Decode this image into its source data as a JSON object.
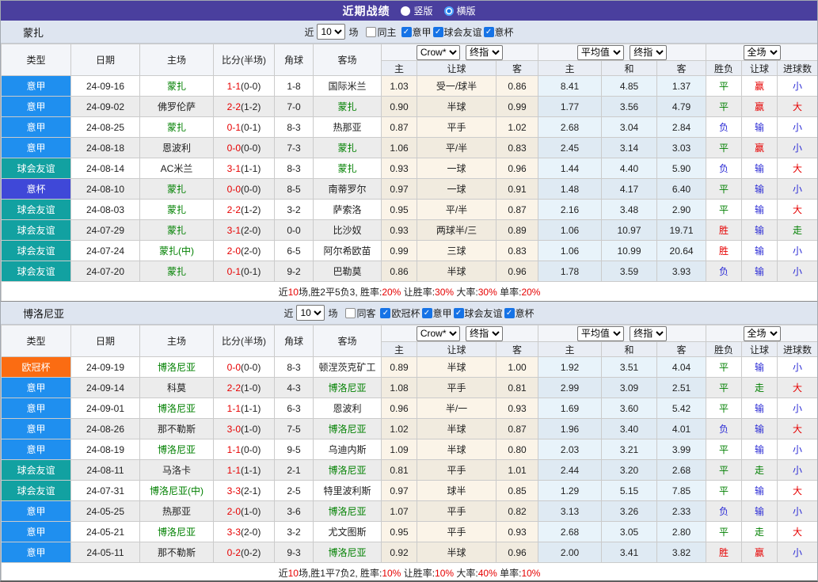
{
  "title_bar": {
    "title": "近期战绩",
    "vertical_label": "竖版",
    "horizontal_label": "横版",
    "selected": "横版"
  },
  "columns": {
    "type": "类型",
    "date": "日期",
    "home": "主场",
    "score": "比分(半场)",
    "corner": "角球",
    "away": "客场",
    "h_home": "主",
    "h_line": "让球",
    "h_away": "客",
    "avg_home": "主",
    "avg_draw": "和",
    "avg_away": "客",
    "result": "胜负",
    "h_result": "让球",
    "g_result": "进球数"
  },
  "type_colors": {
    "意甲": "#1f8fef",
    "球会友谊": "#12a1a1",
    "意杯": "#3f48d8",
    "欧冠杯": "#fb6c12"
  },
  "result_colors": {
    "胜": "#e60000",
    "平": "#008000",
    "负": "#2b2bd5",
    "赢": "#e60000",
    "走": "#008000",
    "输": "#2b2bd5",
    "大": "#e60000",
    "小": "#2b2bd5"
  },
  "sections": [
    {
      "team": "蒙扎",
      "filter": {
        "near_label": "近",
        "games_value": "10",
        "games_suffix": "场",
        "same_label": "同主",
        "same_checked": false,
        "leagues": [
          "意甲",
          "球会友谊",
          "意杯"
        ]
      },
      "dropdowns": {
        "company": "Crow*",
        "company_time": "终指",
        "average": "平均值",
        "average_time": "终指",
        "scope": "全场"
      },
      "rows": [
        {
          "type": "意甲",
          "date": "24-09-16",
          "home": "蒙扎",
          "home_hl": true,
          "score": "1-1",
          "half": "(0-0)",
          "corner": "1-8",
          "away": "国际米兰",
          "away_hl": false,
          "h_home": "1.03",
          "h_line": "受一/球半",
          "h_away": "0.86",
          "avg_home": "8.41",
          "avg_draw": "4.85",
          "avg_away": "1.37",
          "res": "平",
          "h_res": "赢",
          "g_res": "小"
        },
        {
          "type": "意甲",
          "date": "24-09-02",
          "home": "佛罗伦萨",
          "home_hl": false,
          "score": "2-2",
          "half": "(1-2)",
          "corner": "7-0",
          "away": "蒙扎",
          "away_hl": true,
          "h_home": "0.90",
          "h_line": "半球",
          "h_away": "0.99",
          "avg_home": "1.77",
          "avg_draw": "3.56",
          "avg_away": "4.79",
          "res": "平",
          "h_res": "赢",
          "g_res": "大"
        },
        {
          "type": "意甲",
          "date": "24-08-25",
          "home": "蒙扎",
          "home_hl": true,
          "score": "0-1",
          "half": "(0-1)",
          "corner": "8-3",
          "away": "热那亚",
          "away_hl": false,
          "h_home": "0.87",
          "h_line": "平手",
          "h_away": "1.02",
          "avg_home": "2.68",
          "avg_draw": "3.04",
          "avg_away": "2.84",
          "res": "负",
          "h_res": "输",
          "g_res": "小"
        },
        {
          "type": "意甲",
          "date": "24-08-18",
          "home": "恩波利",
          "home_hl": false,
          "score": "0-0",
          "half": "(0-0)",
          "corner": "7-3",
          "away": "蒙扎",
          "away_hl": true,
          "h_home": "1.06",
          "h_line": "平/半",
          "h_away": "0.83",
          "avg_home": "2.45",
          "avg_draw": "3.14",
          "avg_away": "3.03",
          "res": "平",
          "h_res": "赢",
          "g_res": "小"
        },
        {
          "type": "球会友谊",
          "date": "24-08-14",
          "home": "AC米兰",
          "home_hl": false,
          "score": "3-1",
          "half": "(1-1)",
          "corner": "8-3",
          "away": "蒙扎",
          "away_hl": true,
          "h_home": "0.93",
          "h_line": "一球",
          "h_away": "0.96",
          "avg_home": "1.44",
          "avg_draw": "4.40",
          "avg_away": "5.90",
          "res": "负",
          "h_res": "输",
          "g_res": "大"
        },
        {
          "type": "意杯",
          "date": "24-08-10",
          "home": "蒙扎",
          "home_hl": true,
          "score": "0-0",
          "half": "(0-0)",
          "corner": "8-5",
          "away": "南蒂罗尔",
          "away_hl": false,
          "h_home": "0.97",
          "h_line": "一球",
          "h_away": "0.91",
          "avg_home": "1.48",
          "avg_draw": "4.17",
          "avg_away": "6.40",
          "res": "平",
          "h_res": "输",
          "g_res": "小"
        },
        {
          "type": "球会友谊",
          "date": "24-08-03",
          "home": "蒙扎",
          "home_hl": true,
          "score": "2-2",
          "half": "(1-2)",
          "corner": "3-2",
          "away": "萨索洛",
          "away_hl": false,
          "h_home": "0.95",
          "h_line": "平/半",
          "h_away": "0.87",
          "avg_home": "2.16",
          "avg_draw": "3.48",
          "avg_away": "2.90",
          "res": "平",
          "h_res": "输",
          "g_res": "大"
        },
        {
          "type": "球会友谊",
          "date": "24-07-29",
          "home": "蒙扎",
          "home_hl": true,
          "score": "3-1",
          "half": "(2-0)",
          "corner": "0-0",
          "away": "比沙奴",
          "away_hl": false,
          "h_home": "0.93",
          "h_line": "两球半/三",
          "h_away": "0.89",
          "avg_home": "1.06",
          "avg_draw": "10.97",
          "avg_away": "19.71",
          "res": "胜",
          "h_res": "输",
          "g_res": "走"
        },
        {
          "type": "球会友谊",
          "date": "24-07-24",
          "home": "蒙扎(中)",
          "home_hl": true,
          "score": "2-0",
          "half": "(2-0)",
          "corner": "6-5",
          "away": "阿尔希欧苗",
          "away_hl": false,
          "h_home": "0.99",
          "h_line": "三球",
          "h_away": "0.83",
          "avg_home": "1.06",
          "avg_draw": "10.99",
          "avg_away": "20.64",
          "res": "胜",
          "h_res": "输",
          "g_res": "小"
        },
        {
          "type": "球会友谊",
          "date": "24-07-20",
          "home": "蒙扎",
          "home_hl": true,
          "score": "0-1",
          "half": "(0-1)",
          "corner": "9-2",
          "away": "巴勒莫",
          "away_hl": false,
          "h_home": "0.86",
          "h_line": "半球",
          "h_away": "0.96",
          "avg_home": "1.78",
          "avg_draw": "3.59",
          "avg_away": "3.93",
          "res": "负",
          "h_res": "输",
          "g_res": "小"
        }
      ],
      "summary_parts": [
        {
          "t": "近"
        },
        {
          "t": "10",
          "r": true
        },
        {
          "t": "场,胜2平5负3, 胜率:"
        },
        {
          "t": "20%",
          "r": true
        },
        {
          "t": " 让胜率:"
        },
        {
          "t": "30%",
          "r": true
        },
        {
          "t": " 大率:"
        },
        {
          "t": "30%",
          "r": true
        },
        {
          "t": " 单率:"
        },
        {
          "t": "20%",
          "r": true
        }
      ]
    },
    {
      "team": "博洛尼亚",
      "filter": {
        "near_label": "近",
        "games_value": "10",
        "games_suffix": "场",
        "same_label": "同客",
        "same_checked": false,
        "leagues": [
          "欧冠杯",
          "意甲",
          "球会友谊",
          "意杯"
        ]
      },
      "dropdowns": {
        "company": "Crow*",
        "company_time": "终指",
        "average": "平均值",
        "average_time": "终指",
        "scope": "全场"
      },
      "rows": [
        {
          "type": "欧冠杯",
          "date": "24-09-19",
          "home": "博洛尼亚",
          "home_hl": true,
          "score": "0-0",
          "half": "(0-0)",
          "corner": "8-3",
          "away": "顿涅茨克矿工",
          "away_hl": false,
          "h_home": "0.89",
          "h_line": "半球",
          "h_away": "1.00",
          "avg_home": "1.92",
          "avg_draw": "3.51",
          "avg_away": "4.04",
          "res": "平",
          "h_res": "输",
          "g_res": "小"
        },
        {
          "type": "意甲",
          "date": "24-09-14",
          "home": "科莫",
          "home_hl": false,
          "score": "2-2",
          "half": "(1-0)",
          "corner": "4-3",
          "away": "博洛尼亚",
          "away_hl": true,
          "h_home": "1.08",
          "h_line": "平手",
          "h_away": "0.81",
          "avg_home": "2.99",
          "avg_draw": "3.09",
          "avg_away": "2.51",
          "res": "平",
          "h_res": "走",
          "g_res": "大"
        },
        {
          "type": "意甲",
          "date": "24-09-01",
          "home": "博洛尼亚",
          "home_hl": true,
          "score": "1-1",
          "half": "(1-1)",
          "corner": "6-3",
          "away": "恩波利",
          "away_hl": false,
          "h_home": "0.96",
          "h_line": "半/一",
          "h_away": "0.93",
          "avg_home": "1.69",
          "avg_draw": "3.60",
          "avg_away": "5.42",
          "res": "平",
          "h_res": "输",
          "g_res": "小"
        },
        {
          "type": "意甲",
          "date": "24-08-26",
          "home": "那不勒斯",
          "home_hl": false,
          "score": "3-0",
          "half": "(1-0)",
          "corner": "7-5",
          "away": "博洛尼亚",
          "away_hl": true,
          "h_home": "1.02",
          "h_line": "半球",
          "h_away": "0.87",
          "avg_home": "1.96",
          "avg_draw": "3.40",
          "avg_away": "4.01",
          "res": "负",
          "h_res": "输",
          "g_res": "大"
        },
        {
          "type": "意甲",
          "date": "24-08-19",
          "home": "博洛尼亚",
          "home_hl": true,
          "score": "1-1",
          "half": "(0-0)",
          "corner": "9-5",
          "away": "乌迪内斯",
          "away_hl": false,
          "h_home": "1.09",
          "h_line": "半球",
          "h_away": "0.80",
          "avg_home": "2.03",
          "avg_draw": "3.21",
          "avg_away": "3.99",
          "res": "平",
          "h_res": "输",
          "g_res": "小"
        },
        {
          "type": "球会友谊",
          "date": "24-08-11",
          "home": "马洛卡",
          "home_hl": false,
          "score": "1-1",
          "half": "(1-1)",
          "corner": "2-1",
          "away": "博洛尼亚",
          "away_hl": true,
          "h_home": "0.81",
          "h_line": "平手",
          "h_away": "1.01",
          "avg_home": "2.44",
          "avg_draw": "3.20",
          "avg_away": "2.68",
          "res": "平",
          "h_res": "走",
          "g_res": "小"
        },
        {
          "type": "球会友谊",
          "date": "24-07-31",
          "home": "博洛尼亚(中)",
          "home_hl": true,
          "score": "3-3",
          "half": "(2-1)",
          "corner": "2-5",
          "away": "特里波利斯",
          "away_hl": false,
          "h_home": "0.97",
          "h_line": "球半",
          "h_away": "0.85",
          "avg_home": "1.29",
          "avg_draw": "5.15",
          "avg_away": "7.85",
          "res": "平",
          "h_res": "输",
          "g_res": "大"
        },
        {
          "type": "意甲",
          "date": "24-05-25",
          "home": "热那亚",
          "home_hl": false,
          "score": "2-0",
          "half": "(1-0)",
          "corner": "3-6",
          "away": "博洛尼亚",
          "away_hl": true,
          "h_home": "1.07",
          "h_line": "平手",
          "h_away": "0.82",
          "avg_home": "3.13",
          "avg_draw": "3.26",
          "avg_away": "2.33",
          "res": "负",
          "h_res": "输",
          "g_res": "小"
        },
        {
          "type": "意甲",
          "date": "24-05-21",
          "home": "博洛尼亚",
          "home_hl": true,
          "score": "3-3",
          "half": "(2-0)",
          "corner": "3-2",
          "away": "尤文图斯",
          "away_hl": false,
          "h_home": "0.95",
          "h_line": "平手",
          "h_away": "0.93",
          "avg_home": "2.68",
          "avg_draw": "3.05",
          "avg_away": "2.80",
          "res": "平",
          "h_res": "走",
          "g_res": "大"
        },
        {
          "type": "意甲",
          "date": "24-05-11",
          "home": "那不勒斯",
          "home_hl": false,
          "score": "0-2",
          "half": "(0-2)",
          "corner": "9-3",
          "away": "博洛尼亚",
          "away_hl": true,
          "h_home": "0.92",
          "h_line": "半球",
          "h_away": "0.96",
          "avg_home": "2.00",
          "avg_draw": "3.41",
          "avg_away": "3.82",
          "res": "胜",
          "h_res": "赢",
          "g_res": "小"
        }
      ],
      "summary_parts": [
        {
          "t": "近"
        },
        {
          "t": "10",
          "r": true
        },
        {
          "t": "场,胜1平7负2, 胜率:"
        },
        {
          "t": "10%",
          "r": true
        },
        {
          "t": " 让胜率:"
        },
        {
          "t": "10%",
          "r": true
        },
        {
          "t": " 大率:"
        },
        {
          "t": "40%",
          "r": true
        },
        {
          "t": " 单率:"
        },
        {
          "t": "10%",
          "r": true
        }
      ]
    }
  ]
}
